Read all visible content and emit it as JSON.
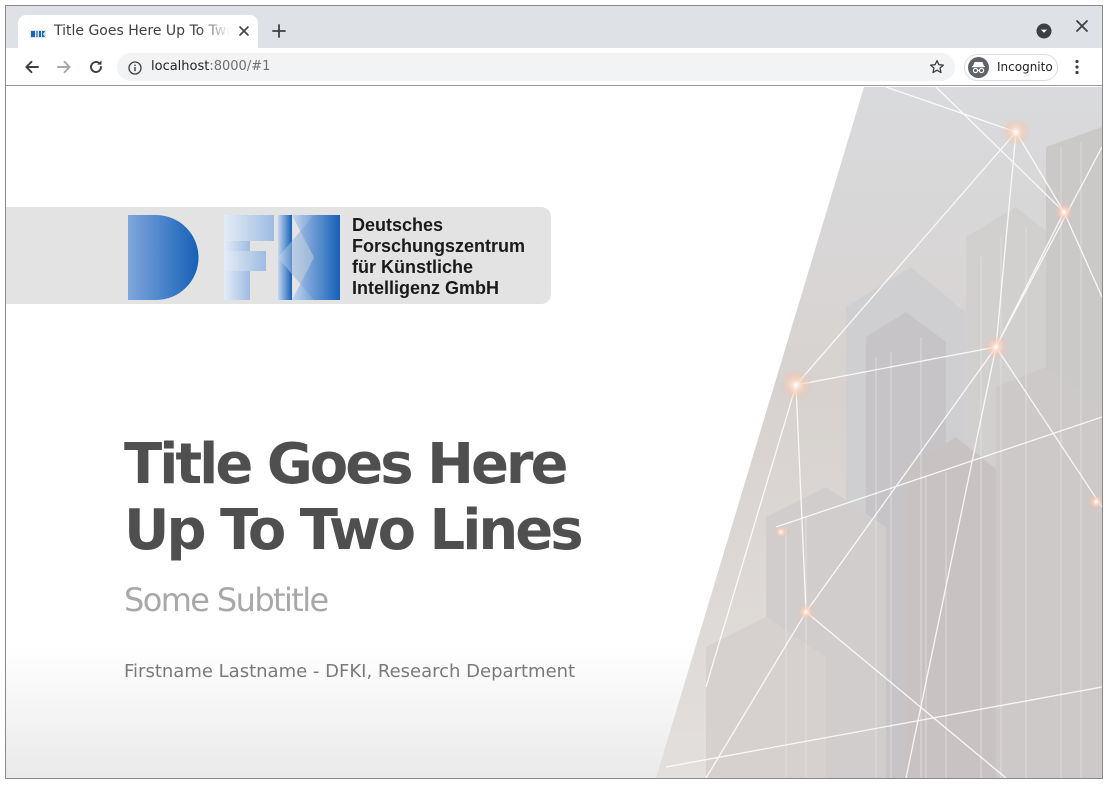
{
  "browser": {
    "tab": {
      "title": "Title Goes Here Up To Two Lines",
      "favicon": "dfki-favicon"
    },
    "new_tab_icon": "plus-icon",
    "tab_search_icon": "chevron-down-circle-icon",
    "close_icon": "close-icon",
    "toolbar": {
      "back_icon": "arrow-left-icon",
      "forward_icon": "arrow-right-icon",
      "reload_icon": "reload-icon",
      "info_icon": "info-icon",
      "bookmark_icon": "star-icon",
      "menu_icon": "kebab-menu-icon"
    },
    "omnibox": {
      "host": "localhost",
      "rest": ":8000/#1"
    },
    "profile": {
      "label": "Incognito",
      "icon": "incognito-icon"
    }
  },
  "slide": {
    "logo": {
      "mark": "DFKI",
      "lines": [
        "Deutsches",
        "Forschungszentrum",
        "für Künstliche",
        "Intelligenz GmbH"
      ]
    },
    "title_lines": [
      "Title Goes Here",
      "Up To Two Lines"
    ],
    "subtitle": "Some Subtitle",
    "author": "Firstname Lastname - DFKI, Research Department"
  },
  "colors": {
    "title": "#4f4f4f",
    "subtitle": "#a8a8a8",
    "author": "#7a7a7a",
    "logo_banner": "#e3e3e3",
    "dfki_blue": "#1560b8",
    "tabstrip": "#dee1e6"
  }
}
